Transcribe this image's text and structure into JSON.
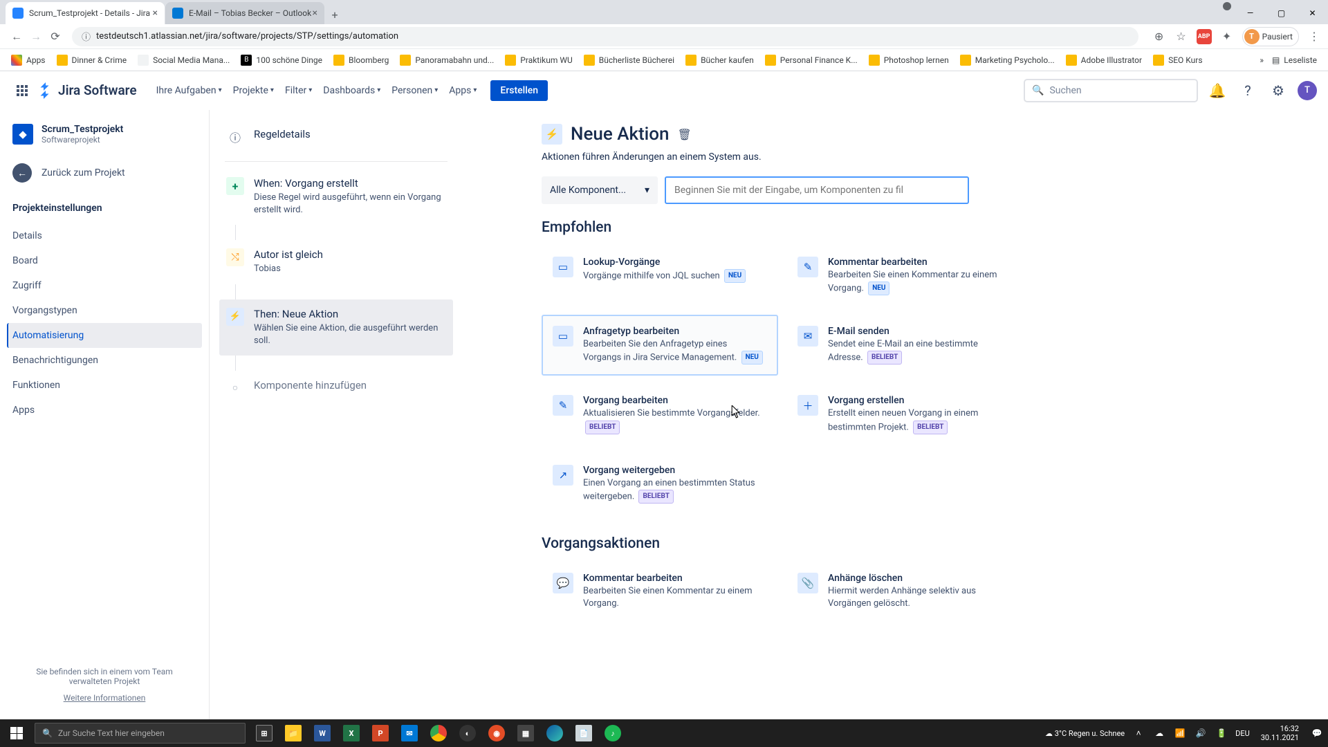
{
  "browser": {
    "tabs": [
      {
        "title": "Scrum_Testprojekt - Details - Jira",
        "active": true
      },
      {
        "title": "E-Mail – Tobias Becker – Outlook",
        "active": false
      }
    ],
    "url": "testdeutsch1.atlassian.net/jira/software/projects/STP/settings/automation",
    "profile_status": "Pausiert",
    "profile_initial": "T",
    "bookmarks": [
      "Apps",
      "Dinner & Crime",
      "Social Media Mana...",
      "100 schöne Dinge",
      "Bloomberg",
      "Panoramabahn und...",
      "Praktikum WU",
      "Bücherliste Bücherei",
      "Bücher kaufen",
      "Personal Finance K...",
      "Photoshop lernen",
      "Marketing Psycholo...",
      "Adobe Illustrator",
      "SEO Kurs"
    ],
    "reading_list": "Leseliste"
  },
  "jira_nav": {
    "product": "Jira Software",
    "items": [
      "Ihre Aufgaben",
      "Projekte",
      "Filter",
      "Dashboards",
      "Personen",
      "Apps"
    ],
    "create": "Erstellen",
    "search": "Suchen"
  },
  "sidebar": {
    "project_name": "Scrum_Testprojekt",
    "project_type": "Softwareprojekt",
    "back": "Zurück zum Projekt",
    "heading": "Projekteinstellungen",
    "items": [
      "Details",
      "Board",
      "Zugriff",
      "Vorgangstypen",
      "Automatisierung",
      "Benachrichtigungen",
      "Funktionen",
      "Apps"
    ],
    "active_index": 4,
    "footer1": "Sie befinden sich in einem vom Team verwalteten Projekt",
    "footer2": "Weitere Informationen"
  },
  "rule": {
    "details": "Regeldetails",
    "trigger_title": "When: Vorgang erstellt",
    "trigger_desc": "Diese Regel wird ausgeführt, wenn ein Vorgang erstellt wird.",
    "cond_title": "Autor ist gleich",
    "cond_desc": "Tobias",
    "action_title": "Then: Neue Aktion",
    "action_desc": "Wählen Sie eine Aktion, die ausgeführt werden soll.",
    "add": "Komponente hinzufügen"
  },
  "panel": {
    "title": "Neue Aktion",
    "subtitle": "Aktionen führen Änderungen an einem System aus.",
    "dropdown": "Alle Komponent...",
    "search_placeholder": "Beginnen Sie mit der Eingabe, um Komponenten zu fil",
    "section_recommend": "Empfohlen",
    "section_issue": "Vorgangsaktionen",
    "badge_neu": "NEU",
    "badge_beliebt": "BELIEBT",
    "cards_recommend": [
      {
        "title": "Lookup-Vorgänge",
        "desc": "Vorgänge mithilfe von JQL suchen",
        "badge": "neu",
        "icon": "▭"
      },
      {
        "title": "Kommentar bearbeiten",
        "desc": "Bearbeiten Sie einen Kommentar zu einem Vorgang.",
        "badge": "neu",
        "icon": "✎"
      },
      {
        "title": "Anfragetyp bearbeiten",
        "desc": "Bearbeiten Sie den Anfragetyp eines Vorgangs in Jira Service Management.",
        "badge": "neu",
        "hovered": true,
        "icon": "▭"
      },
      {
        "title": "E-Mail senden",
        "desc": "Sendet eine E-Mail an eine bestimmte Adresse.",
        "badge": "beliebt",
        "icon": "✉"
      },
      {
        "title": "Vorgang bearbeiten",
        "desc": "Aktualisieren Sie bestimmte Vorgangsfelder.",
        "badge": "beliebt",
        "icon": "✎"
      },
      {
        "title": "Vorgang erstellen",
        "desc": "Erstellt einen neuen Vorgang in einem bestimmten Projekt.",
        "badge": "beliebt",
        "icon": "＋"
      },
      {
        "title": "Vorgang weitergeben",
        "desc": "Einen Vorgang an einen bestimmten Status weitergeben.",
        "badge": "beliebt",
        "icon": "↗"
      }
    ],
    "cards_issue": [
      {
        "title": "Kommentar bearbeiten",
        "desc": "Bearbeiten Sie einen Kommentar zu einem Vorgang.",
        "icon": "💬"
      },
      {
        "title": "Anhänge löschen",
        "desc": "Hiermit werden Anhänge selektiv aus Vorgängen gelöscht.",
        "icon": "📎"
      }
    ]
  },
  "taskbar": {
    "search": "Zur Suche Text hier eingeben",
    "weather": "3°C  Regen u. Schnee",
    "lang": "DEU",
    "time": "16:32",
    "date": "30.11.2021"
  }
}
